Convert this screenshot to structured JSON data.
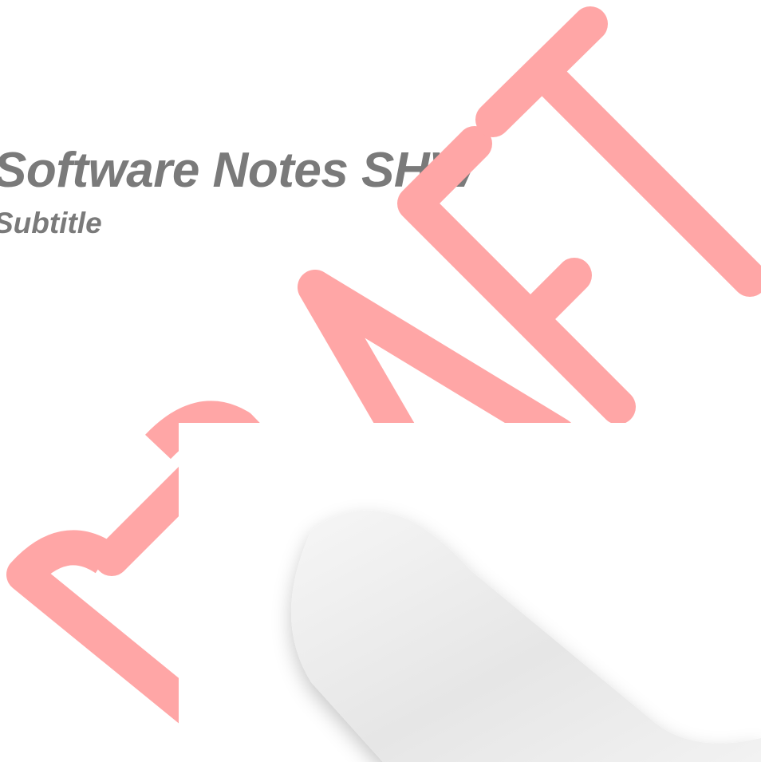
{
  "document": {
    "title": "Software Notes SHW",
    "subtitle": "Subtitle"
  },
  "watermark": {
    "text": "DRAFT",
    "color": "#ffa6a6"
  },
  "colors": {
    "title_text": "#7a7a7a",
    "background": "#ffffff"
  }
}
